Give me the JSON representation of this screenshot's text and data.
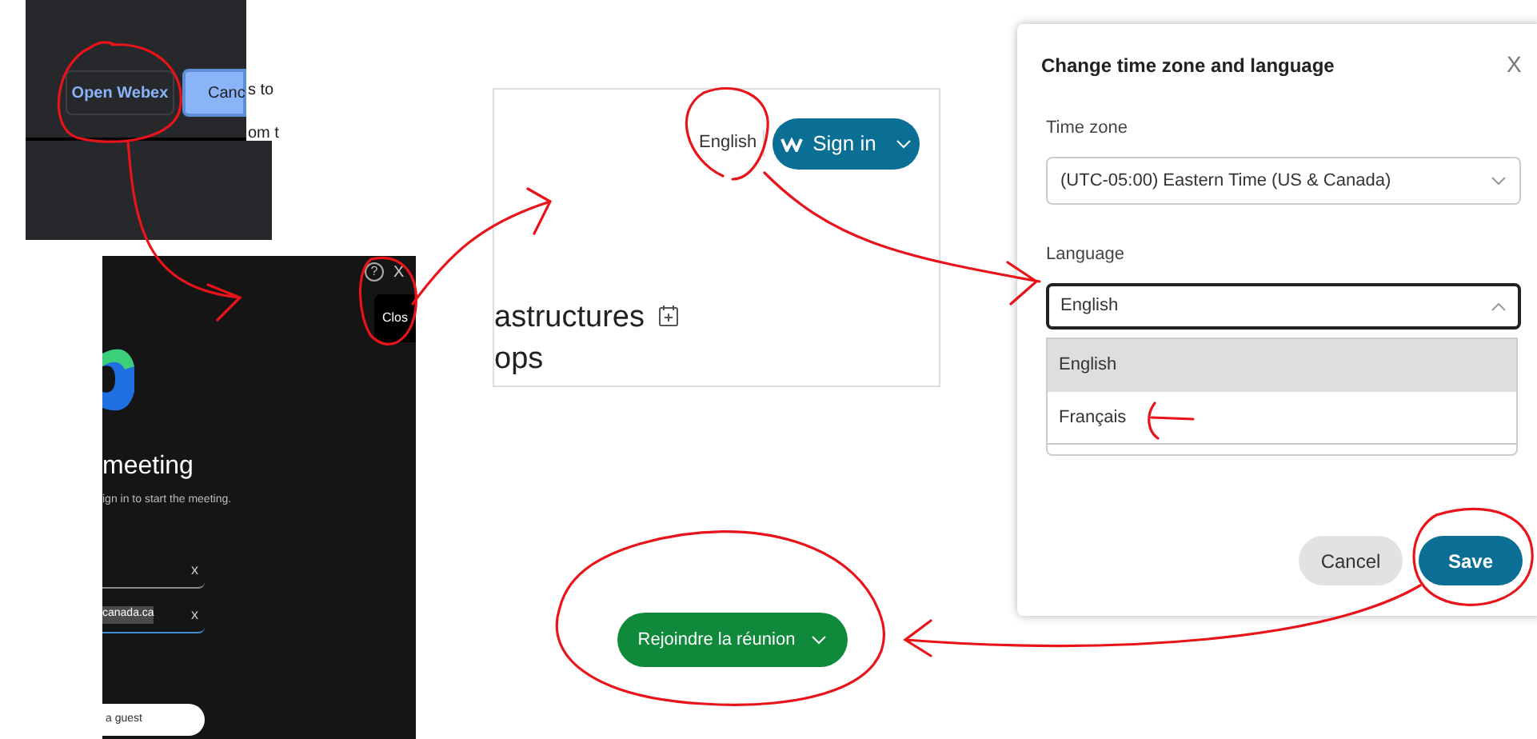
{
  "browser_prompt": {
    "open_button": "Open Webex",
    "cancel_button": "Canc",
    "side_texts": [
      "s to",
      "om t"
    ]
  },
  "meeting_app": {
    "help_icon": "?",
    "close_icon": "X",
    "close_button": "Clos",
    "heading": "meeting",
    "subtitle": "ign in to start the meeting.",
    "fields": [
      {
        "clear": "x",
        "focused": false
      },
      {
        "value": "canada.ca",
        "clear": "x",
        "focused": true
      }
    ],
    "guest_button": "a guest"
  },
  "web_page": {
    "language_link": "English",
    "sign_in_button": "Sign in",
    "heading_lines": [
      "astructures",
      "ops"
    ]
  },
  "dialog": {
    "title": "Change time zone and language",
    "close": "X",
    "time_zone_label": "Time zone",
    "time_zone_value": "(UTC-05:00) Eastern Time (US & Canada)",
    "language_label": "Language",
    "language_value": "English",
    "options": [
      {
        "label": "English",
        "selected": true
      },
      {
        "label": "Français",
        "selected": false
      }
    ],
    "buttons": [
      {
        "label": "Cancel",
        "kind": "secondary"
      },
      {
        "label": "Save",
        "kind": "primary"
      }
    ]
  },
  "join_button": "Rejoindre la réunion"
}
